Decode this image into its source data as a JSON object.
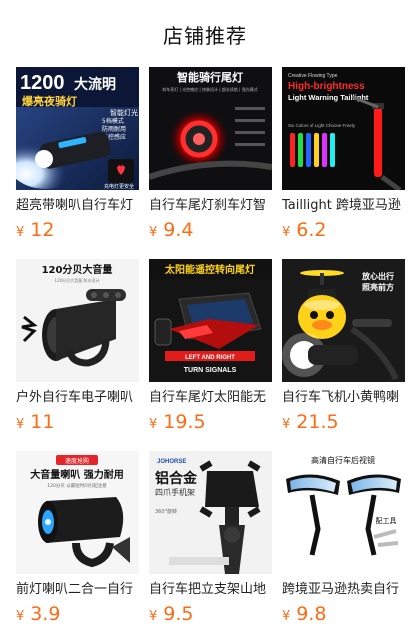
{
  "header": {
    "title": "店铺推荐"
  },
  "currency": "¥",
  "products": [
    {
      "name": "超亮带喇叭自行车灯",
      "price": "12",
      "icon": "bike-headlight-image",
      "img_text": {
        "big": "1200",
        "unit": "大流明",
        "sub": "爆亮夜骑灯",
        "f1": "5档模式",
        "f2": "防雨耐用",
        "f3": "光控感应",
        "tag": "智能灯光",
        "badge": "充电灯更安全"
      }
    },
    {
      "name": "自行车尾灯刹车灯智",
      "price": "9.4",
      "icon": "smart-taillight-image",
      "img_text": {
        "t1": "智能骑行尾灯",
        "t2": "刹车亮灯 | 光控感应 | 快装设计 | 超长续航 | 强光模式"
      }
    },
    {
      "name": "Taillight 跨境亚马逊",
      "price": "6.2",
      "icon": "led-taillight-image",
      "img_text": {
        "t0": "Creative Flowing Type",
        "t1": "High-brightness",
        "t2": "Light Warning Taillight",
        "t3": "Six Colors of Light  Choose Freely"
      }
    },
    {
      "name": "户外自行车电子喇叭",
      "price": "11",
      "icon": "bike-horn-image",
      "img_text": {
        "t1": "120分贝大音量",
        "t2": "120分贝大音量 防水设计"
      }
    },
    {
      "name": "自行车尾灯太阳能无",
      "price": "19.5",
      "icon": "solar-taillight-image",
      "img_text": {
        "t1": "太阳能遥控转向尾灯",
        "t2": "LEFT AND RIGHT",
        "t3": "TURN SIGNALS"
      }
    },
    {
      "name": "自行车飞机小黄鸭喇",
      "price": "21.5",
      "icon": "duck-bell-image",
      "img_text": {
        "t1": "放心出行",
        "t2": "照亮前方"
      }
    },
    {
      "name": "前灯喇叭二合一自行",
      "price": "3.9",
      "icon": "horn-light-combo-image",
      "img_text": {
        "tag": "速度抢购",
        "t1": "大音量喇叭 强力耐用",
        "t2": "120分贝 以最短时间引起注意"
      }
    },
    {
      "name": "自行车把立支架山地",
      "price": "9.5",
      "icon": "phone-holder-image",
      "img_text": {
        "brand": "JOHORSE",
        "t1": "铝合金",
        "t2": "四爪手机架",
        "t3": "360°旋转"
      }
    },
    {
      "name": "跨境亚马逊热卖自行",
      "price": "9.8",
      "icon": "bike-mirror-image",
      "img_text": {
        "t1": "高清自行车后视镜",
        "t2": "配工具"
      }
    }
  ]
}
